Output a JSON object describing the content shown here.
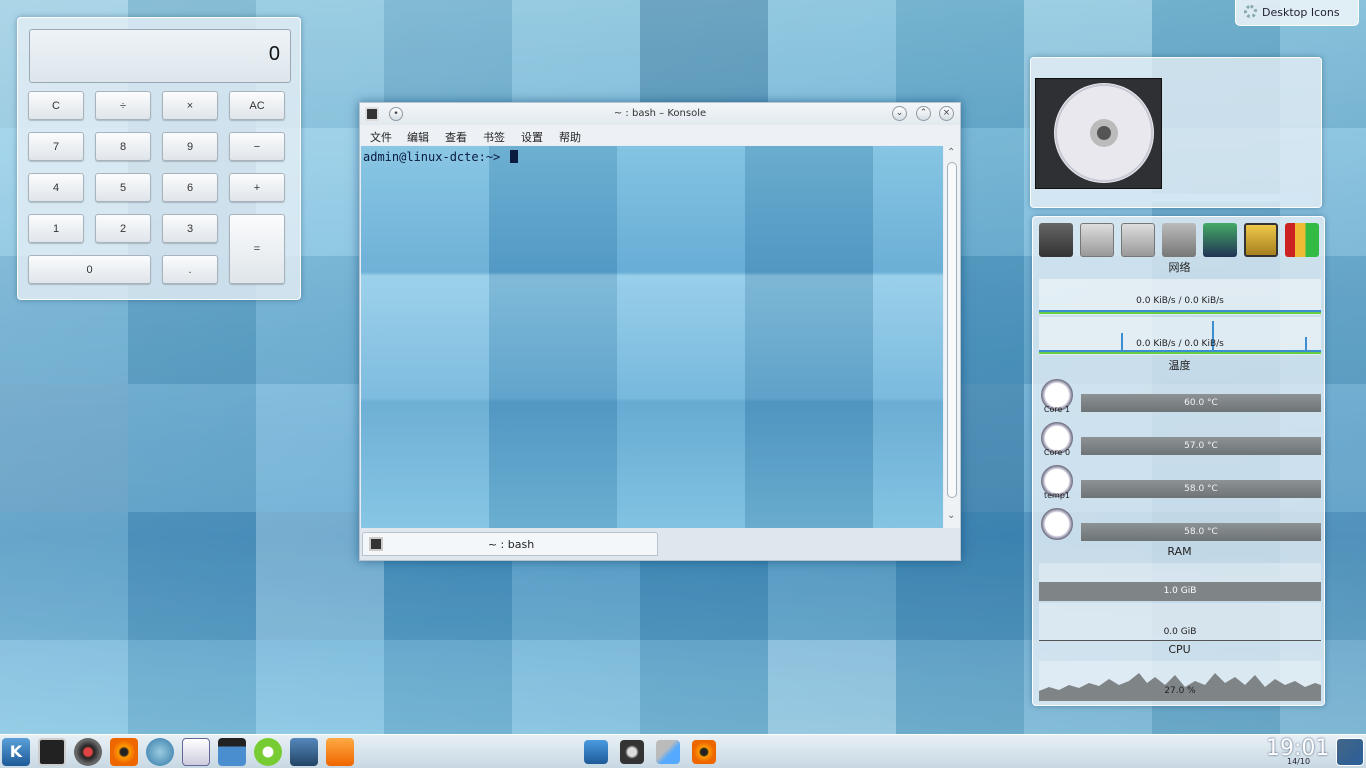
{
  "desktop": {
    "desktop_icons_label": "Desktop Icons"
  },
  "calculator": {
    "display": "0",
    "buttons": {
      "c": "C",
      "div": "÷",
      "mul": "×",
      "ac": "AC",
      "b7": "7",
      "b8": "8",
      "b9": "9",
      "minus": "−",
      "b4": "4",
      "b5": "5",
      "b6": "6",
      "plus": "+",
      "b1": "1",
      "b2": "2",
      "b3": "3",
      "eq": "=",
      "b0": "0",
      "dot": "."
    }
  },
  "konsole": {
    "title": "~ : bash – Konsole",
    "menu": [
      "文件",
      "编辑",
      "查看",
      "书签",
      "设置",
      "帮助"
    ],
    "prompt": "admin@linux-dcte:~>",
    "tab_label": "~ : bash"
  },
  "sysmon": {
    "network_label": "网络",
    "net_rate_1": "0.0 KiB/s / 0.0 KiB/s",
    "net_rate_2": "0.0 KiB/s / 0.0 KiB/s",
    "temp_label": "温度",
    "sensors": [
      {
        "name": "Core 1",
        "value": "60.0 °C"
      },
      {
        "name": "Core 0",
        "value": "57.0 °C"
      },
      {
        "name": "temp1",
        "value": "58.0 °C"
      },
      {
        "name": "",
        "value": "58.0 °C"
      }
    ],
    "ram_label": "RAM",
    "ram_used": "1.0 GiB",
    "swap_used": "0.0 GiB",
    "cpu_label": "CPU",
    "cpu_value": "27.0 %"
  },
  "taskbar": {
    "time": "19:01",
    "date": "14/10",
    "launchers": [
      "kickoff-icon",
      "terminal-icon",
      "webcam-icon",
      "eye-icon",
      "browser-icon",
      "document-icon",
      "video-icon",
      "mail-icon",
      "monitor-icon",
      "rss-icon"
    ]
  },
  "colors": {
    "accent": "#3b8fd0",
    "terminal_text": "#0b1b40"
  }
}
